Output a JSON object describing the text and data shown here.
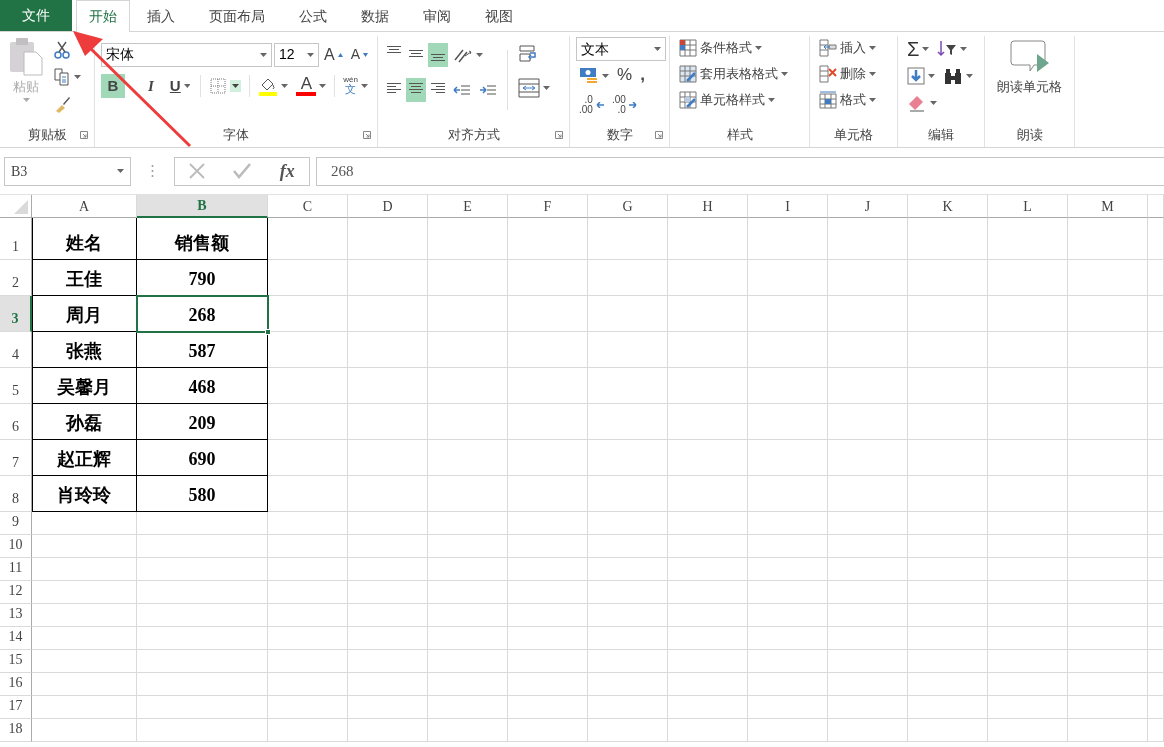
{
  "menu_tabs": [
    {
      "label": "文件",
      "kind": "file",
      "selected": false
    },
    {
      "label": "开始",
      "kind": "tab",
      "selected": true
    },
    {
      "label": "插入",
      "kind": "tab",
      "selected": false
    },
    {
      "label": "页面布局",
      "kind": "tab",
      "selected": false
    },
    {
      "label": "公式",
      "kind": "tab",
      "selected": false
    },
    {
      "label": "数据",
      "kind": "tab",
      "selected": false
    },
    {
      "label": "审阅",
      "kind": "tab",
      "selected": false
    },
    {
      "label": "视图",
      "kind": "tab",
      "selected": false
    }
  ],
  "clipboard": {
    "paste_label": "粘贴",
    "paste_disabled": true,
    "group_label": "剪贴板"
  },
  "font": {
    "name": "宋体",
    "size": "12",
    "grow_glyph": "A",
    "shrink_glyph": "A",
    "bold_glyph": "B",
    "italic_glyph": "I",
    "underline_glyph": "U",
    "bold": true,
    "italic": false,
    "underline": false,
    "font_color_glyph": "A",
    "phonetic_top": "wén",
    "phonetic_bottom": "文",
    "group_label": "字体"
  },
  "alignment": {
    "top": false,
    "middle": false,
    "bottom": true,
    "left": false,
    "center": true,
    "right": false,
    "group_label": "对齐方式"
  },
  "number": {
    "format": "文本",
    "percent": "%",
    "comma": ",",
    "increase_decimal": [
      ".0",
      ".00"
    ],
    "decrease_decimal": [
      ".00",
      ".0"
    ],
    "group_label": "数字"
  },
  "styles": {
    "items": [
      "条件格式",
      "套用表格格式",
      "单元格样式"
    ],
    "group_label": "样式"
  },
  "cells": {
    "items": [
      "插入",
      "删除",
      "格式"
    ],
    "group_label": "单元格"
  },
  "editing": {
    "sum_glyph": "Σ",
    "group_label": "编辑"
  },
  "read_aloud": {
    "button": "朗读单元格",
    "group_label": "朗读"
  },
  "formula_bar": {
    "name_box": "B3",
    "function_glyph": "fx",
    "value": "268"
  },
  "sheet": {
    "columns": [
      {
        "label": "A",
        "selected": false
      },
      {
        "label": "B",
        "selected": true
      },
      {
        "label": "C",
        "selected": false
      },
      {
        "label": "D",
        "selected": false
      },
      {
        "label": "E",
        "selected": false
      },
      {
        "label": "F",
        "selected": false
      },
      {
        "label": "G",
        "selected": false
      },
      {
        "label": "H",
        "selected": false
      },
      {
        "label": "I",
        "selected": false
      },
      {
        "label": "J",
        "selected": false
      },
      {
        "label": "K",
        "selected": false
      },
      {
        "label": "L",
        "selected": false
      },
      {
        "label": "M",
        "selected": false
      }
    ],
    "rows": [
      {
        "header": "1",
        "selected": false,
        "cells": [
          "姓名",
          "销售额"
        ]
      },
      {
        "header": "2",
        "selected": false,
        "cells": [
          "王佳",
          "790"
        ]
      },
      {
        "header": "3",
        "selected": true,
        "cells": [
          "周月",
          "268"
        ]
      },
      {
        "header": "4",
        "selected": false,
        "cells": [
          "张燕",
          "587"
        ]
      },
      {
        "header": "5",
        "selected": false,
        "cells": [
          "吴馨月",
          "468"
        ]
      },
      {
        "header": "6",
        "selected": false,
        "cells": [
          "孙磊",
          "209"
        ]
      },
      {
        "header": "7",
        "selected": false,
        "cells": [
          "赵正辉",
          "690"
        ]
      },
      {
        "header": "8",
        "selected": false,
        "cells": [
          "肖玲玲",
          "580"
        ]
      },
      {
        "header": "9",
        "selected": false,
        "cells": []
      },
      {
        "header": "10",
        "selected": false,
        "cells": []
      },
      {
        "header": "11",
        "selected": false,
        "cells": []
      },
      {
        "header": "12",
        "selected": false,
        "cells": []
      },
      {
        "header": "13",
        "selected": false,
        "cells": []
      },
      {
        "header": "14",
        "selected": false,
        "cells": []
      },
      {
        "header": "15",
        "selected": false,
        "cells": []
      },
      {
        "header": "16",
        "selected": false,
        "cells": []
      },
      {
        "header": "17",
        "selected": false,
        "cells": []
      },
      {
        "header": "18",
        "selected": false,
        "cells": []
      }
    ]
  }
}
